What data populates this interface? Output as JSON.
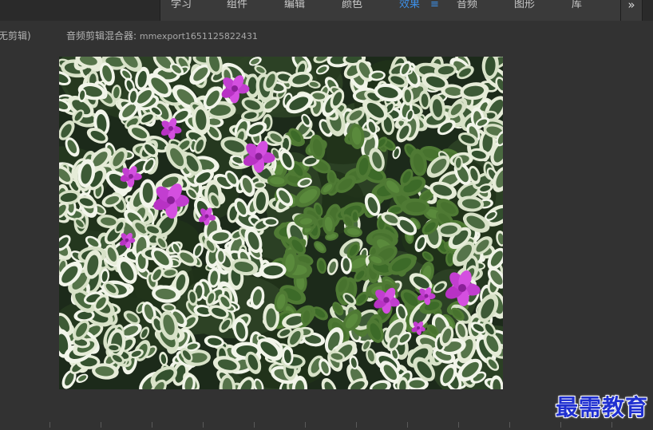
{
  "workspace": {
    "tabs": [
      {
        "label": "学习",
        "active": false
      },
      {
        "label": "组件",
        "active": false
      },
      {
        "label": "编辑",
        "active": false
      },
      {
        "label": "颜色",
        "active": false
      },
      {
        "label": "效果",
        "active": true
      },
      {
        "label": "音频",
        "active": false
      },
      {
        "label": "图形",
        "active": false
      },
      {
        "label": "库",
        "active": false
      }
    ],
    "menu_glyph": "≡",
    "overflow_glyph": "»"
  },
  "panels": {
    "source_label": "无剪辑)",
    "mixer_label": "音频剪辑混合器:",
    "mixer_clip": "mmexport1651125822431"
  },
  "monitor": {
    "content": "photo-foliage-flowers"
  },
  "colors": {
    "accent": "#3d8fe6",
    "background": "#323232",
    "watermark": "#1f2fd0"
  },
  "watermark": {
    "text": "最需教育"
  }
}
